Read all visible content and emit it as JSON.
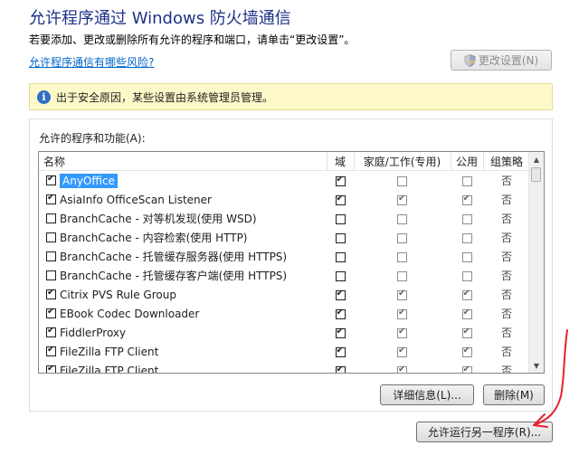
{
  "page": {
    "title": "允许程序通过 Windows 防火墙通信",
    "subtitle": "若要添加、更改或删除所有允许的程序和端口，请单击“更改设置”。",
    "risk_link": "允许程序通信有哪些风险?",
    "change_settings_label": "更改设置(N)"
  },
  "info_bar": {
    "text": "出于安全原因，某些设置由系统管理员管理。",
    "icon": "info-icon"
  },
  "list": {
    "group_label": "允许的程序和功能(A):",
    "columns": [
      "名称",
      "域",
      "家庭/工作(专用)",
      "公用",
      "组策略"
    ],
    "rows": [
      {
        "name": "AnyOffice",
        "enabled": true,
        "domain": true,
        "private": false,
        "public": false,
        "policy": "否",
        "selected": true
      },
      {
        "name": "AsiaInfo OfficeScan Listener",
        "enabled": true,
        "domain": true,
        "private": true,
        "public": true,
        "policy": "否"
      },
      {
        "name": "BranchCache - 对等机发现(使用 WSD)",
        "enabled": false,
        "domain": false,
        "private": false,
        "public": false,
        "policy": "否"
      },
      {
        "name": "BranchCache - 内容检索(使用 HTTP)",
        "enabled": false,
        "domain": false,
        "private": false,
        "public": false,
        "policy": "否"
      },
      {
        "name": "BranchCache - 托管缓存服务器(使用 HTTPS)",
        "enabled": false,
        "domain": false,
        "private": false,
        "public": false,
        "policy": "否"
      },
      {
        "name": "BranchCache - 托管缓存客户端(使用 HTTPS)",
        "enabled": false,
        "domain": false,
        "private": false,
        "public": false,
        "policy": "否"
      },
      {
        "name": "Citrix PVS Rule Group",
        "enabled": true,
        "domain": true,
        "private": true,
        "public": true,
        "policy": "否"
      },
      {
        "name": "EBook Codec Downloader",
        "enabled": true,
        "domain": true,
        "private": true,
        "public": true,
        "policy": "否"
      },
      {
        "name": "FiddlerProxy",
        "enabled": true,
        "domain": true,
        "private": true,
        "public": true,
        "policy": "否"
      },
      {
        "name": "FileZilla FTP Client",
        "enabled": true,
        "domain": true,
        "private": true,
        "public": true,
        "policy": "否"
      },
      {
        "name": "FileZilla FTP Client",
        "enabled": true,
        "domain": true,
        "private": true,
        "public": true,
        "policy": "否"
      }
    ]
  },
  "buttons": {
    "details": "详细信息(L)...",
    "remove": "删除(M)",
    "allow_another": "允许运行另一程序(R)..."
  },
  "colors": {
    "title": "#1e3287",
    "link": "#0066cc",
    "selection": "#3399ff",
    "info_bg": "#fdf9c9",
    "annotation": "#e8202a"
  }
}
